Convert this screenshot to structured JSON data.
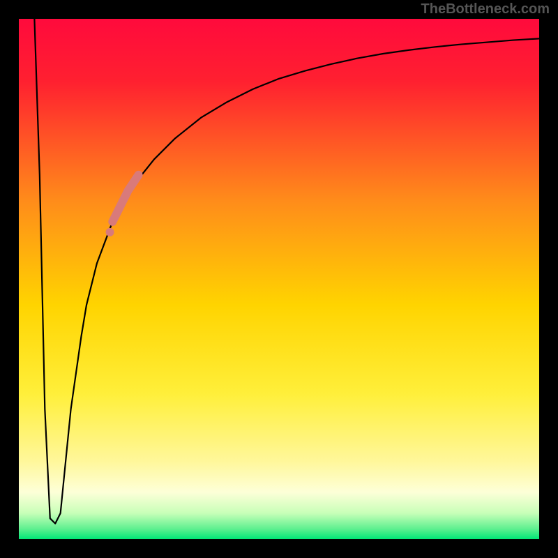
{
  "watermark": "TheBottleneck.com",
  "chart_data": {
    "type": "line",
    "title": "",
    "xlabel": "",
    "ylabel": "",
    "xlim": [
      0,
      100
    ],
    "ylim": [
      0,
      100
    ],
    "grid": false,
    "legend": false,
    "annotations": [],
    "gradient_colors": [
      "#ff0033",
      "#ffcc00",
      "#ffff66",
      "#ffffcc",
      "#00e676"
    ],
    "series": [
      {
        "name": "curve",
        "color": "#000000",
        "x": [
          3,
          4,
          5,
          6,
          7,
          8,
          9,
          10,
          11,
          12,
          13,
          15,
          18,
          22,
          26,
          30,
          35,
          40,
          45,
          50,
          55,
          60,
          65,
          70,
          75,
          80,
          85,
          90,
          95,
          100
        ],
        "y": [
          100,
          70,
          25,
          4,
          3,
          5,
          15,
          25,
          32,
          39,
          45,
          53,
          61,
          68,
          73,
          77,
          81,
          84,
          86.5,
          88.5,
          90,
          91.3,
          92.4,
          93.3,
          94,
          94.6,
          95.1,
          95.5,
          95.9,
          96.2
        ]
      },
      {
        "name": "highlight-segment",
        "color": "#d97a7a",
        "x": [
          18,
          19,
          20,
          21,
          22,
          23
        ],
        "y": [
          61,
          63,
          65,
          67,
          68.5,
          70
        ]
      },
      {
        "name": "highlight-dot",
        "color": "#d97a7a",
        "type": "scatter",
        "x": [
          17.5
        ],
        "y": [
          59
        ]
      }
    ]
  }
}
